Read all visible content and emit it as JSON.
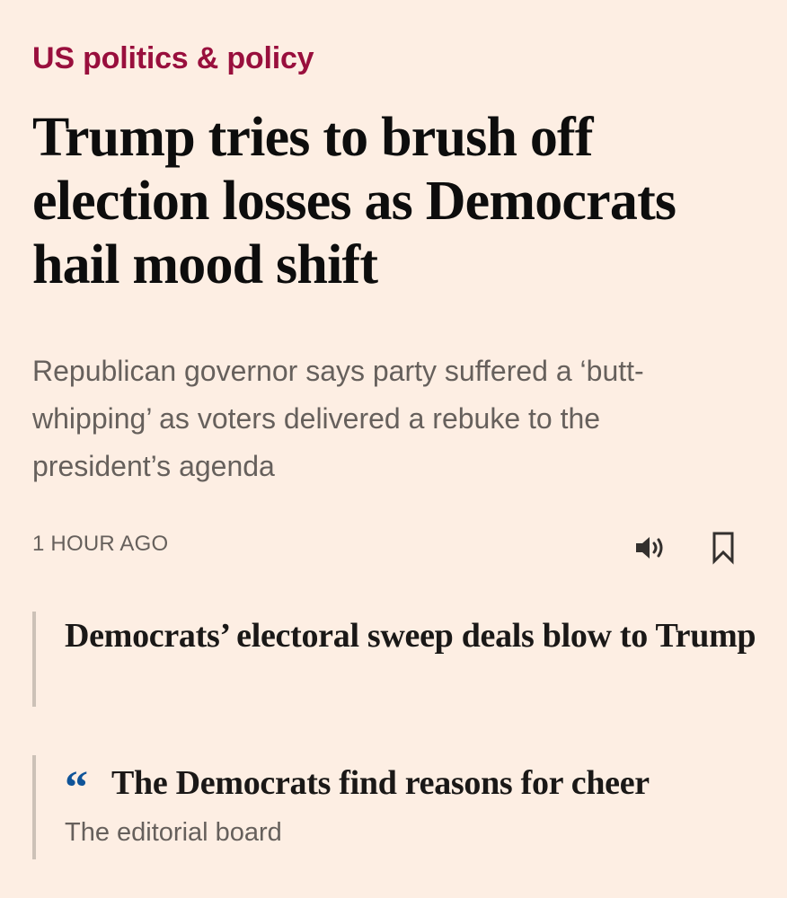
{
  "article": {
    "topic": "US politics & policy",
    "headline": "Trump tries to brush off election losses as Democrats hail mood shift",
    "standfirst": "Republican governor says party suffered a ‘butt-whipping’ as voters delivered a rebuke to the president’s agenda",
    "timestamp": "1 HOUR AGO",
    "actions": {
      "listen_icon": "speaker-icon",
      "save_icon": "bookmark-icon"
    }
  },
  "related": [
    {
      "title": "Democrats’ electoral sweep deals blow to Trump"
    },
    {
      "quote_mark": "“",
      "title": "The Democrats find reasons for cheer",
      "byline": "The editorial board"
    }
  ],
  "colors": {
    "background": "#fdeee3",
    "topic": "#990f3d",
    "text": "#1a1817",
    "secondary_text": "#66605c",
    "opinion_quote": "#0f5499",
    "rule": "#ccc1b7"
  }
}
